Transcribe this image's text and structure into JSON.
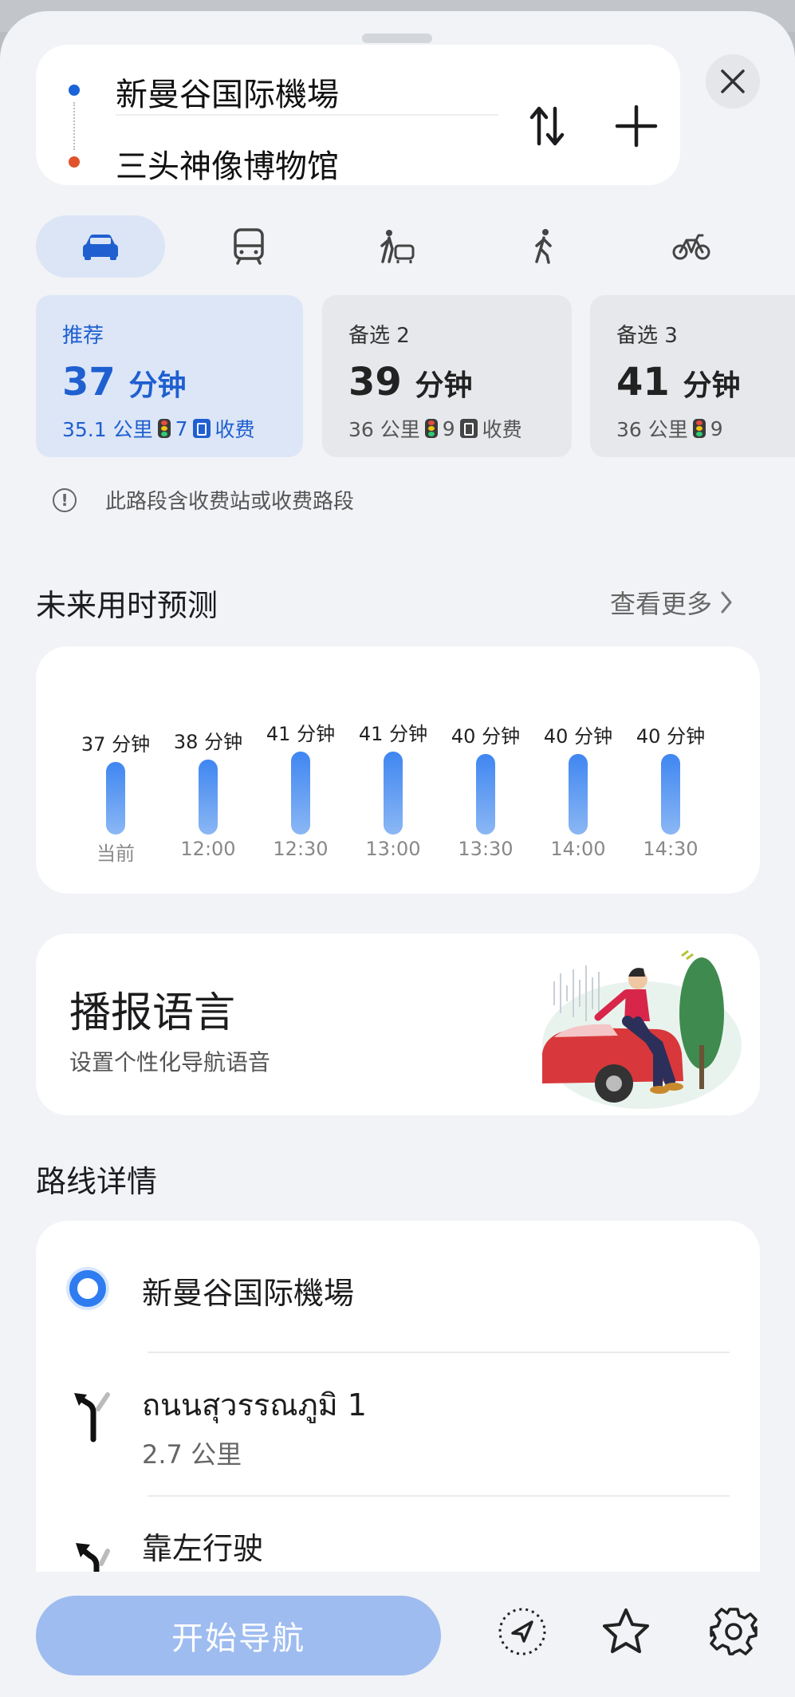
{
  "route": {
    "from": "新曼谷国际機場",
    "to": "三头神像博物馆"
  },
  "modes": [
    "car",
    "transit",
    "taxi",
    "walk",
    "bike"
  ],
  "options": [
    {
      "label": "推荐",
      "minutes": "37",
      "unit": "分钟",
      "distance": "35.1 公里",
      "lights": "7",
      "toll": "收费",
      "recommended": true
    },
    {
      "label": "备选 2",
      "minutes": "39",
      "unit": "分钟",
      "distance": "36 公里",
      "lights": "9",
      "toll": "收费",
      "recommended": false
    },
    {
      "label": "备选 3",
      "minutes": "41",
      "unit": "分钟",
      "distance": "36 公里",
      "lights": "9",
      "toll": "",
      "recommended": false
    }
  ],
  "notice": "此路段含收费站或收费路段",
  "forecast": {
    "title": "未来用时预测",
    "more": "查看更多"
  },
  "chart_data": {
    "type": "bar",
    "categories": [
      "当前",
      "12:00",
      "12:30",
      "13:00",
      "13:30",
      "14:00",
      "14:30"
    ],
    "values": [
      37,
      38,
      41,
      41,
      40,
      40,
      40
    ],
    "value_labels": [
      "37 分钟",
      "38 分钟",
      "41 分钟",
      "41 分钟",
      "40 分钟",
      "40 分钟",
      "40 分钟"
    ],
    "grid": false
  },
  "voice": {
    "title": "播报语言",
    "subtitle": "设置个性化导航语音"
  },
  "details": {
    "title": "路线详情",
    "start": "新曼谷国际機場",
    "steps": [
      {
        "name": "ถนนสุวรรณภูมิ 1",
        "distance": "2.7 公里",
        "icon": "turn-left-slight-icon"
      },
      {
        "name": "靠左行驶",
        "distance": "",
        "icon": "keep-left-icon"
      }
    ]
  },
  "bottom": {
    "start_label": "开始导航"
  },
  "colors": {
    "accent": "#1f5fd0",
    "bar": "#4a8df2",
    "start_button": "#9ebcf0"
  }
}
